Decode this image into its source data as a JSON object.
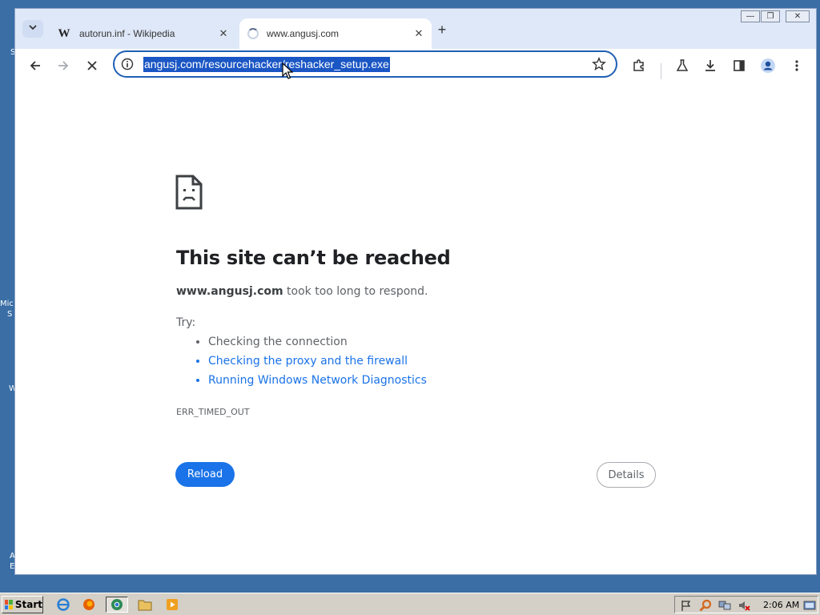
{
  "desktop": {
    "fragments": [
      "S",
      "Mic",
      "S",
      "W",
      "A",
      "E"
    ]
  },
  "window_controls": {
    "minimize": "—",
    "restore": "❐",
    "close": "✕"
  },
  "tabs": [
    {
      "title": "autorun.inf - Wikipedia",
      "favicon": "W",
      "active": false
    },
    {
      "title": "www.angusj.com",
      "favicon": "loading-spinner",
      "active": true
    }
  ],
  "address_bar": {
    "url": "angusj.com/resourcehacker/reshacker_setup.exe"
  },
  "error_page": {
    "title": "This site can’t be reached",
    "host": "www.angusj.com",
    "description": " took too long to respond.",
    "try_label": "Try:",
    "suggestions": [
      {
        "text": "Checking the connection",
        "link": false
      },
      {
        "text": "Checking the proxy and the firewall",
        "link": true
      },
      {
        "text": "Running Windows Network Diagnostics",
        "link": true
      }
    ],
    "error_code": "ERR_TIMED_OUT",
    "reload_label": "Reload",
    "details_label": "Details"
  },
  "taskbar": {
    "start_label": "Start",
    "clock": "2:06 AM"
  },
  "colors": {
    "accent": "#1a73e8",
    "desktop": "#3a6ea5",
    "selection": "#1a56c4"
  }
}
